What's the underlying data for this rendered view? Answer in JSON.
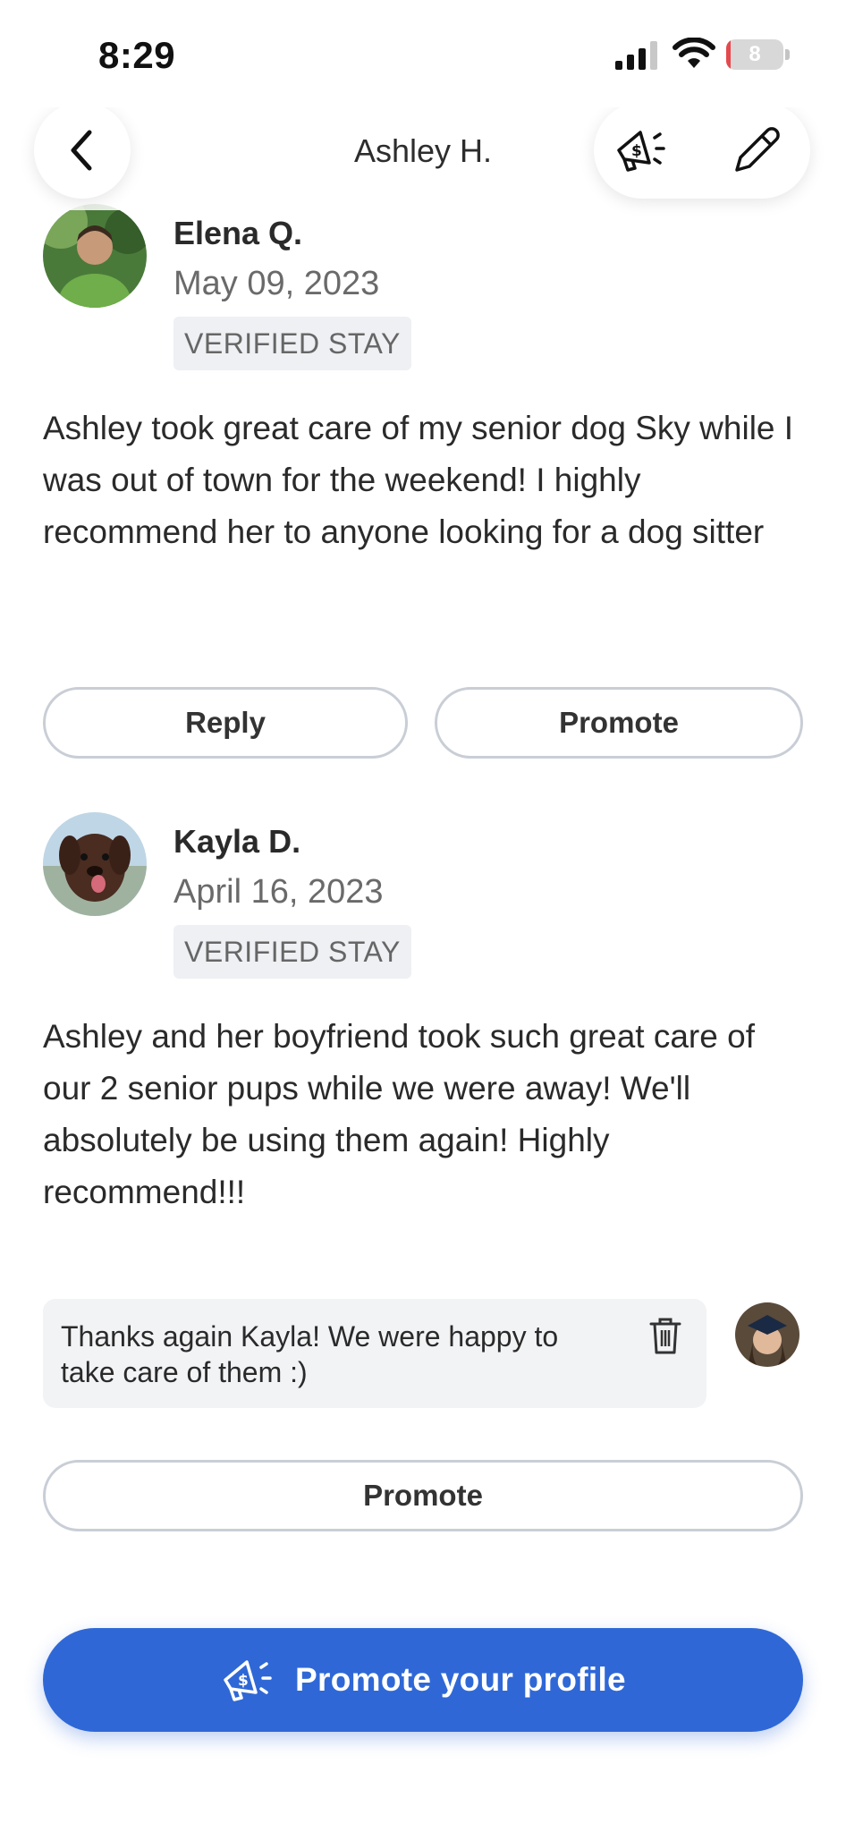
{
  "status_bar": {
    "time": "8:29",
    "battery_level": "8",
    "battery_fraction": 0.08
  },
  "header": {
    "title": "Ashley H.",
    "back_icon": "chevron-left-icon",
    "promote_icon": "megaphone-dollar-icon",
    "edit_icon": "pencil-icon"
  },
  "reviews": [
    {
      "name": "Elena Q.",
      "date": "May 09, 2023",
      "badge": "VERIFIED STAY",
      "text": "Ashley took great care of my senior dog Sky while I was out of town for the weekend! I highly recommend her to anyone looking for a dog sitter",
      "reply_label": "Reply",
      "promote_label": "Promote"
    },
    {
      "name": "Kayla D.",
      "date": "April 16, 2023",
      "badge": "VERIFIED STAY",
      "text": "Ashley and her boyfriend took such great care of our 2 senior pups while we were away! We'll absolutely be using them again! Highly recommend!!!",
      "reply": {
        "text": "Thanks again Kayla! We were happy to take care of them :)",
        "delete_icon": "trash-icon"
      },
      "promote_label": "Promote"
    }
  ],
  "cta": {
    "label": "Promote your profile",
    "icon": "megaphone-dollar-icon",
    "color": "#2f68d6"
  }
}
